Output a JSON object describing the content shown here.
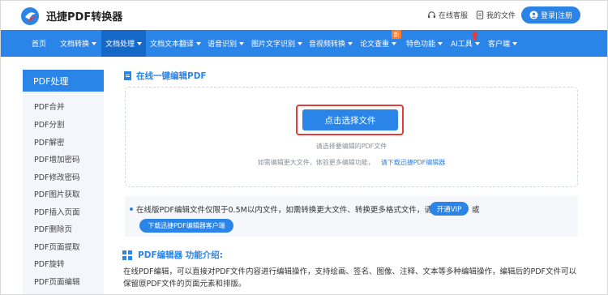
{
  "header": {
    "brand": "迅捷PDF转换器",
    "service_label": "在线客服",
    "files_label": "我的文件",
    "login_label": "登录|注册"
  },
  "nav": {
    "items": [
      {
        "label": "首页",
        "dropdown": false
      },
      {
        "label": "文档转换",
        "dropdown": true
      },
      {
        "label": "文档处理",
        "dropdown": true,
        "active": true
      },
      {
        "label": "文档文本翻译",
        "dropdown": true
      },
      {
        "label": "语音识别",
        "dropdown": true
      },
      {
        "label": "图片文字识别",
        "dropdown": true
      },
      {
        "label": "音视频转换",
        "dropdown": true
      },
      {
        "label": "论文查重",
        "dropdown": true
      },
      {
        "label": "特色功能",
        "dropdown": true
      },
      {
        "label": "AI工具",
        "dropdown": true
      },
      {
        "label": "客户端",
        "dropdown": true
      }
    ],
    "new_badge": "新"
  },
  "sidebar": {
    "title": "PDF处理",
    "items": [
      {
        "label": "PDF合并"
      },
      {
        "label": "PDF分割"
      },
      {
        "label": "PDF解密"
      },
      {
        "label": "PDF增加密码"
      },
      {
        "label": "PDF修改密码"
      },
      {
        "label": "PDF图片获取"
      },
      {
        "label": "PDF插入页面"
      },
      {
        "label": "PDF删除页"
      },
      {
        "label": "PDF页面提取"
      },
      {
        "label": "PDF旋转"
      },
      {
        "label": "PDF页面编辑"
      }
    ]
  },
  "main": {
    "section_title": "在线一键编辑PDF",
    "select_button": "点击选择文件",
    "hint1": "请选择要编辑的PDF文件",
    "hint2": "如需编辑更大文件，体验更多编辑功能，",
    "hint2_link": "请下载迅捷PDF编辑器",
    "notice_text": "在线版PDF编辑文件仅限于0.5M以内文件，如需转换更大文件、转换更多格式文件，请",
    "vip_button": "开通VIP",
    "notice_or": "或",
    "download_client_button": "下载迅捷PDF编辑器客户端",
    "intro_title": "PDF编辑器 功能介绍:",
    "intro_text": "在线PDF编辑，可以直接对PDF文件内容进行编辑操作，支持绘画、签名、图像、注释、文本等多种编辑操作，编辑后的PDF文件可以保留原PDF文件的页面元素和排版。"
  },
  "colors": {
    "primary": "#2b84e8",
    "nav_active": "#1668c6",
    "highlight_outline": "#e23d3d",
    "badge": "#ff7a2b"
  }
}
